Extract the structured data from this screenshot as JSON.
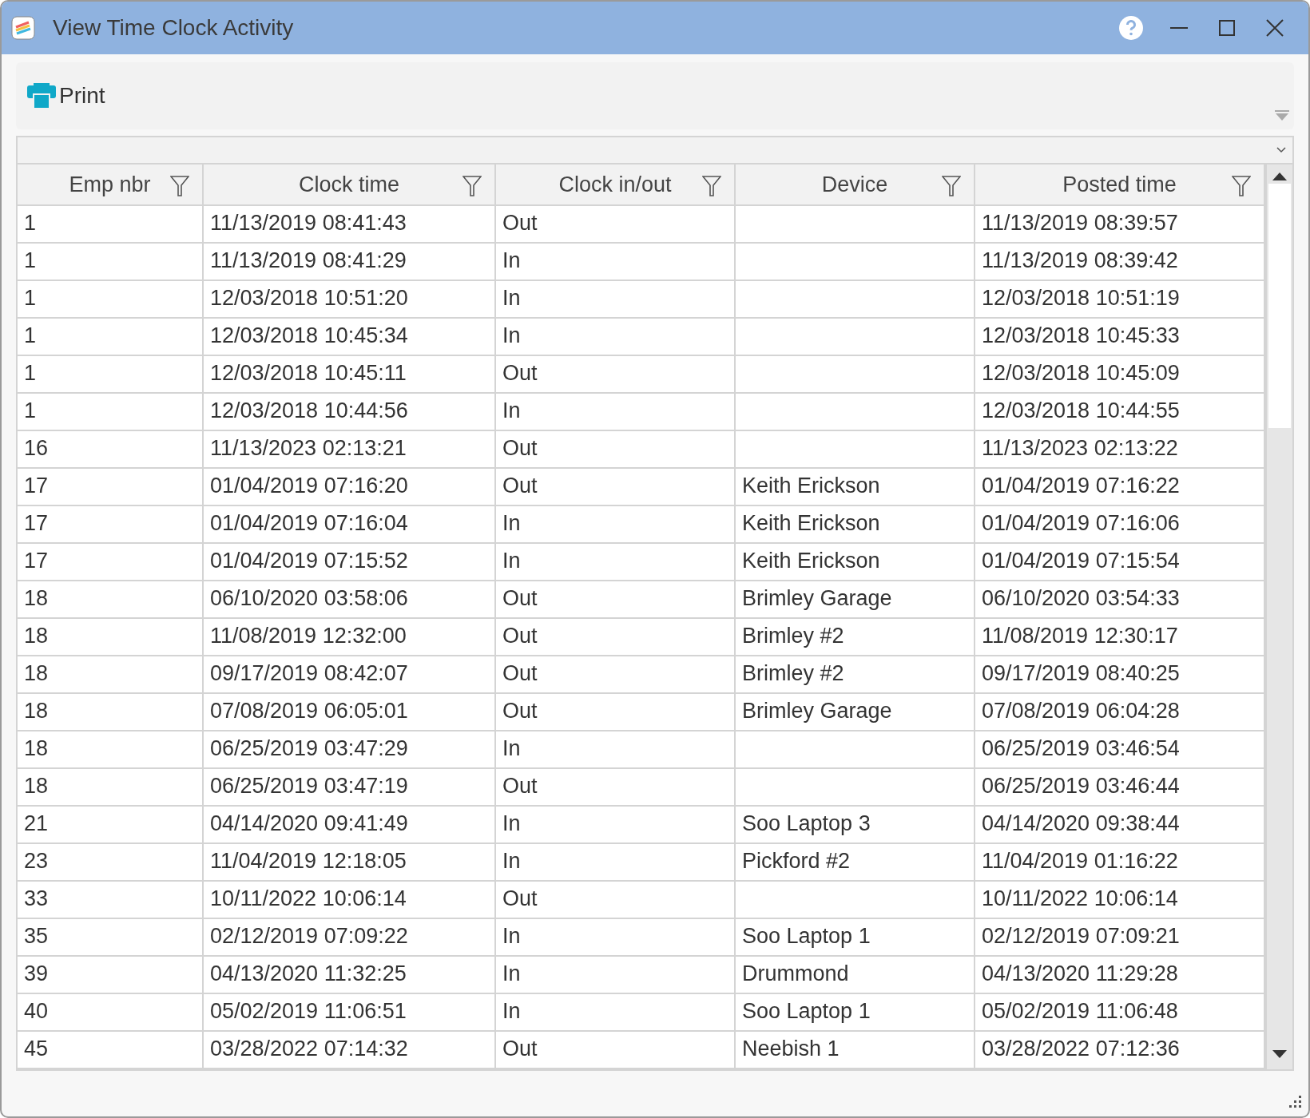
{
  "window": {
    "title": "View Time Clock Activity"
  },
  "toolbar": {
    "buttons": [
      "Print"
    ]
  },
  "table": {
    "columns": [
      "Emp nbr",
      "Clock time",
      "Clock in/out",
      "Device",
      "Posted time"
    ],
    "rows": [
      [
        "1",
        "11/13/2019 08:41:43",
        "Out",
        "",
        "11/13/2019 08:39:57"
      ],
      [
        "1",
        "11/13/2019 08:41:29",
        "In",
        "",
        "11/13/2019 08:39:42"
      ],
      [
        "1",
        "12/03/2018 10:51:20",
        "In",
        "",
        "12/03/2018 10:51:19"
      ],
      [
        "1",
        "12/03/2018 10:45:34",
        "In",
        "",
        "12/03/2018 10:45:33"
      ],
      [
        "1",
        "12/03/2018 10:45:11",
        "Out",
        "",
        "12/03/2018 10:45:09"
      ],
      [
        "1",
        "12/03/2018 10:44:56",
        "In",
        "",
        "12/03/2018 10:44:55"
      ],
      [
        "16",
        "11/13/2023 02:13:21",
        "Out",
        "",
        "11/13/2023 02:13:22"
      ],
      [
        "17",
        "01/04/2019 07:16:20",
        "Out",
        "Keith Erickson",
        "01/04/2019 07:16:22"
      ],
      [
        "17",
        "01/04/2019 07:16:04",
        "In",
        "Keith Erickson",
        "01/04/2019 07:16:06"
      ],
      [
        "17",
        "01/04/2019 07:15:52",
        "In",
        "Keith Erickson",
        "01/04/2019 07:15:54"
      ],
      [
        "18",
        "06/10/2020 03:58:06",
        "Out",
        "Brimley Garage",
        "06/10/2020 03:54:33"
      ],
      [
        "18",
        "11/08/2019 12:32:00",
        "Out",
        "Brimley #2",
        "11/08/2019 12:30:17"
      ],
      [
        "18",
        "09/17/2019 08:42:07",
        "Out",
        "Brimley #2",
        "09/17/2019 08:40:25"
      ],
      [
        "18",
        "07/08/2019 06:05:01",
        "Out",
        "Brimley Garage",
        "07/08/2019 06:04:28"
      ],
      [
        "18",
        "06/25/2019 03:47:29",
        "In",
        "",
        "06/25/2019 03:46:54"
      ],
      [
        "18",
        "06/25/2019 03:47:19",
        "Out",
        "",
        "06/25/2019 03:46:44"
      ],
      [
        "21",
        "04/14/2020 09:41:49",
        "In",
        "Soo Laptop 3",
        "04/14/2020 09:38:44"
      ],
      [
        "23",
        "11/04/2019 12:18:05",
        "In",
        "Pickford #2",
        "11/04/2019 01:16:22"
      ],
      [
        "33",
        "10/11/2022 10:06:14",
        "Out",
        "",
        "10/11/2022 10:06:14"
      ],
      [
        "35",
        "02/12/2019 07:09:22",
        "In",
        "Soo Laptop 1",
        "02/12/2019 07:09:21"
      ],
      [
        "39",
        "04/13/2020 11:32:25",
        "In",
        "Drummond",
        "04/13/2020 11:29:28"
      ],
      [
        "40",
        "05/02/2019 11:06:51",
        "In",
        "Soo Laptop 1",
        "05/02/2019 11:06:48"
      ],
      [
        "45",
        "03/28/2022 07:14:32",
        "Out",
        "Neebish 1",
        "03/28/2022 07:12:36"
      ]
    ]
  }
}
